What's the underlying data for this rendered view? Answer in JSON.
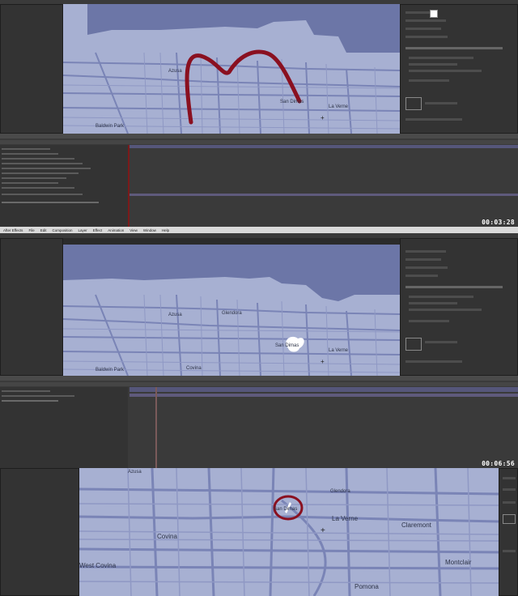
{
  "app": {
    "menu": [
      "After Effects",
      "File",
      "Edit",
      "Composition",
      "Layer",
      "Effect",
      "Animation",
      "View",
      "Window",
      "Help"
    ]
  },
  "frames": [
    {
      "timecode": "00:03:28",
      "map_labels": [
        "Azusa",
        "San Dimas",
        "La Verne",
        "Baldwin Park"
      ]
    },
    {
      "timecode": "00:06:56",
      "map_labels": [
        "Azusa",
        "Glendora",
        "San Dimas",
        "La Verne",
        "Covina",
        "Baldwin Park"
      ]
    },
    {
      "map_labels": [
        "Azusa",
        "Glendora",
        "San Dimas",
        "La Verne",
        "Claremont",
        "Covina",
        "West Covina",
        "Montclair",
        "Pomona"
      ]
    }
  ],
  "colors": {
    "map_bg": "#a7b0d2",
    "map_dark": "#6c76a7",
    "road": "#7a84b6",
    "route": "#8a1020",
    "ui_dark": "#2b2b2b",
    "timeline_track": "#55567a"
  },
  "icons": [
    "crosshair-icon"
  ]
}
